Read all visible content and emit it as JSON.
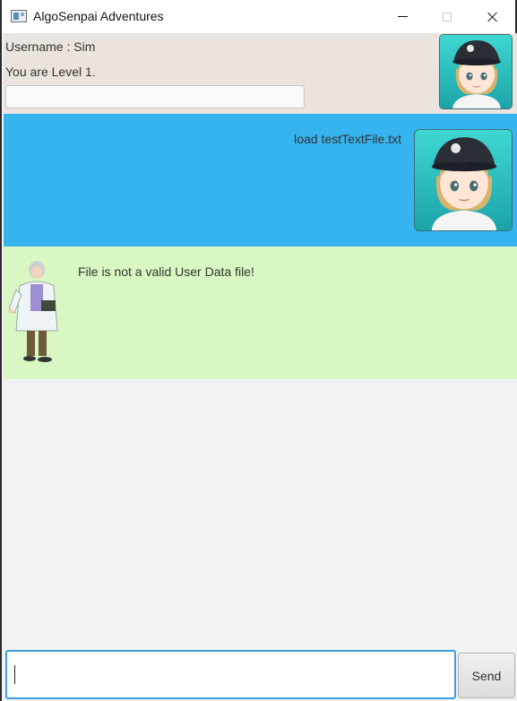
{
  "window": {
    "title": "AlgoSenpai Adventures"
  },
  "header": {
    "username": "Username : Sim",
    "level": "You are Level 1.",
    "progress": 0
  },
  "dialog": {
    "user_message": "load testTextFile.txt",
    "bot_message": "File is not a valid User Data file!"
  },
  "input": {
    "value": "",
    "send_label": "Send"
  },
  "colors": {
    "user_row": "#35b4ef",
    "bot_row": "#d9f7c2",
    "header_bg": "#ebe4de",
    "input_border": "#3d9fd8"
  },
  "icons": {
    "app": "app-window-icon",
    "minimize": "minimize-icon",
    "maximize": "maximize-icon",
    "close": "close-icon"
  }
}
